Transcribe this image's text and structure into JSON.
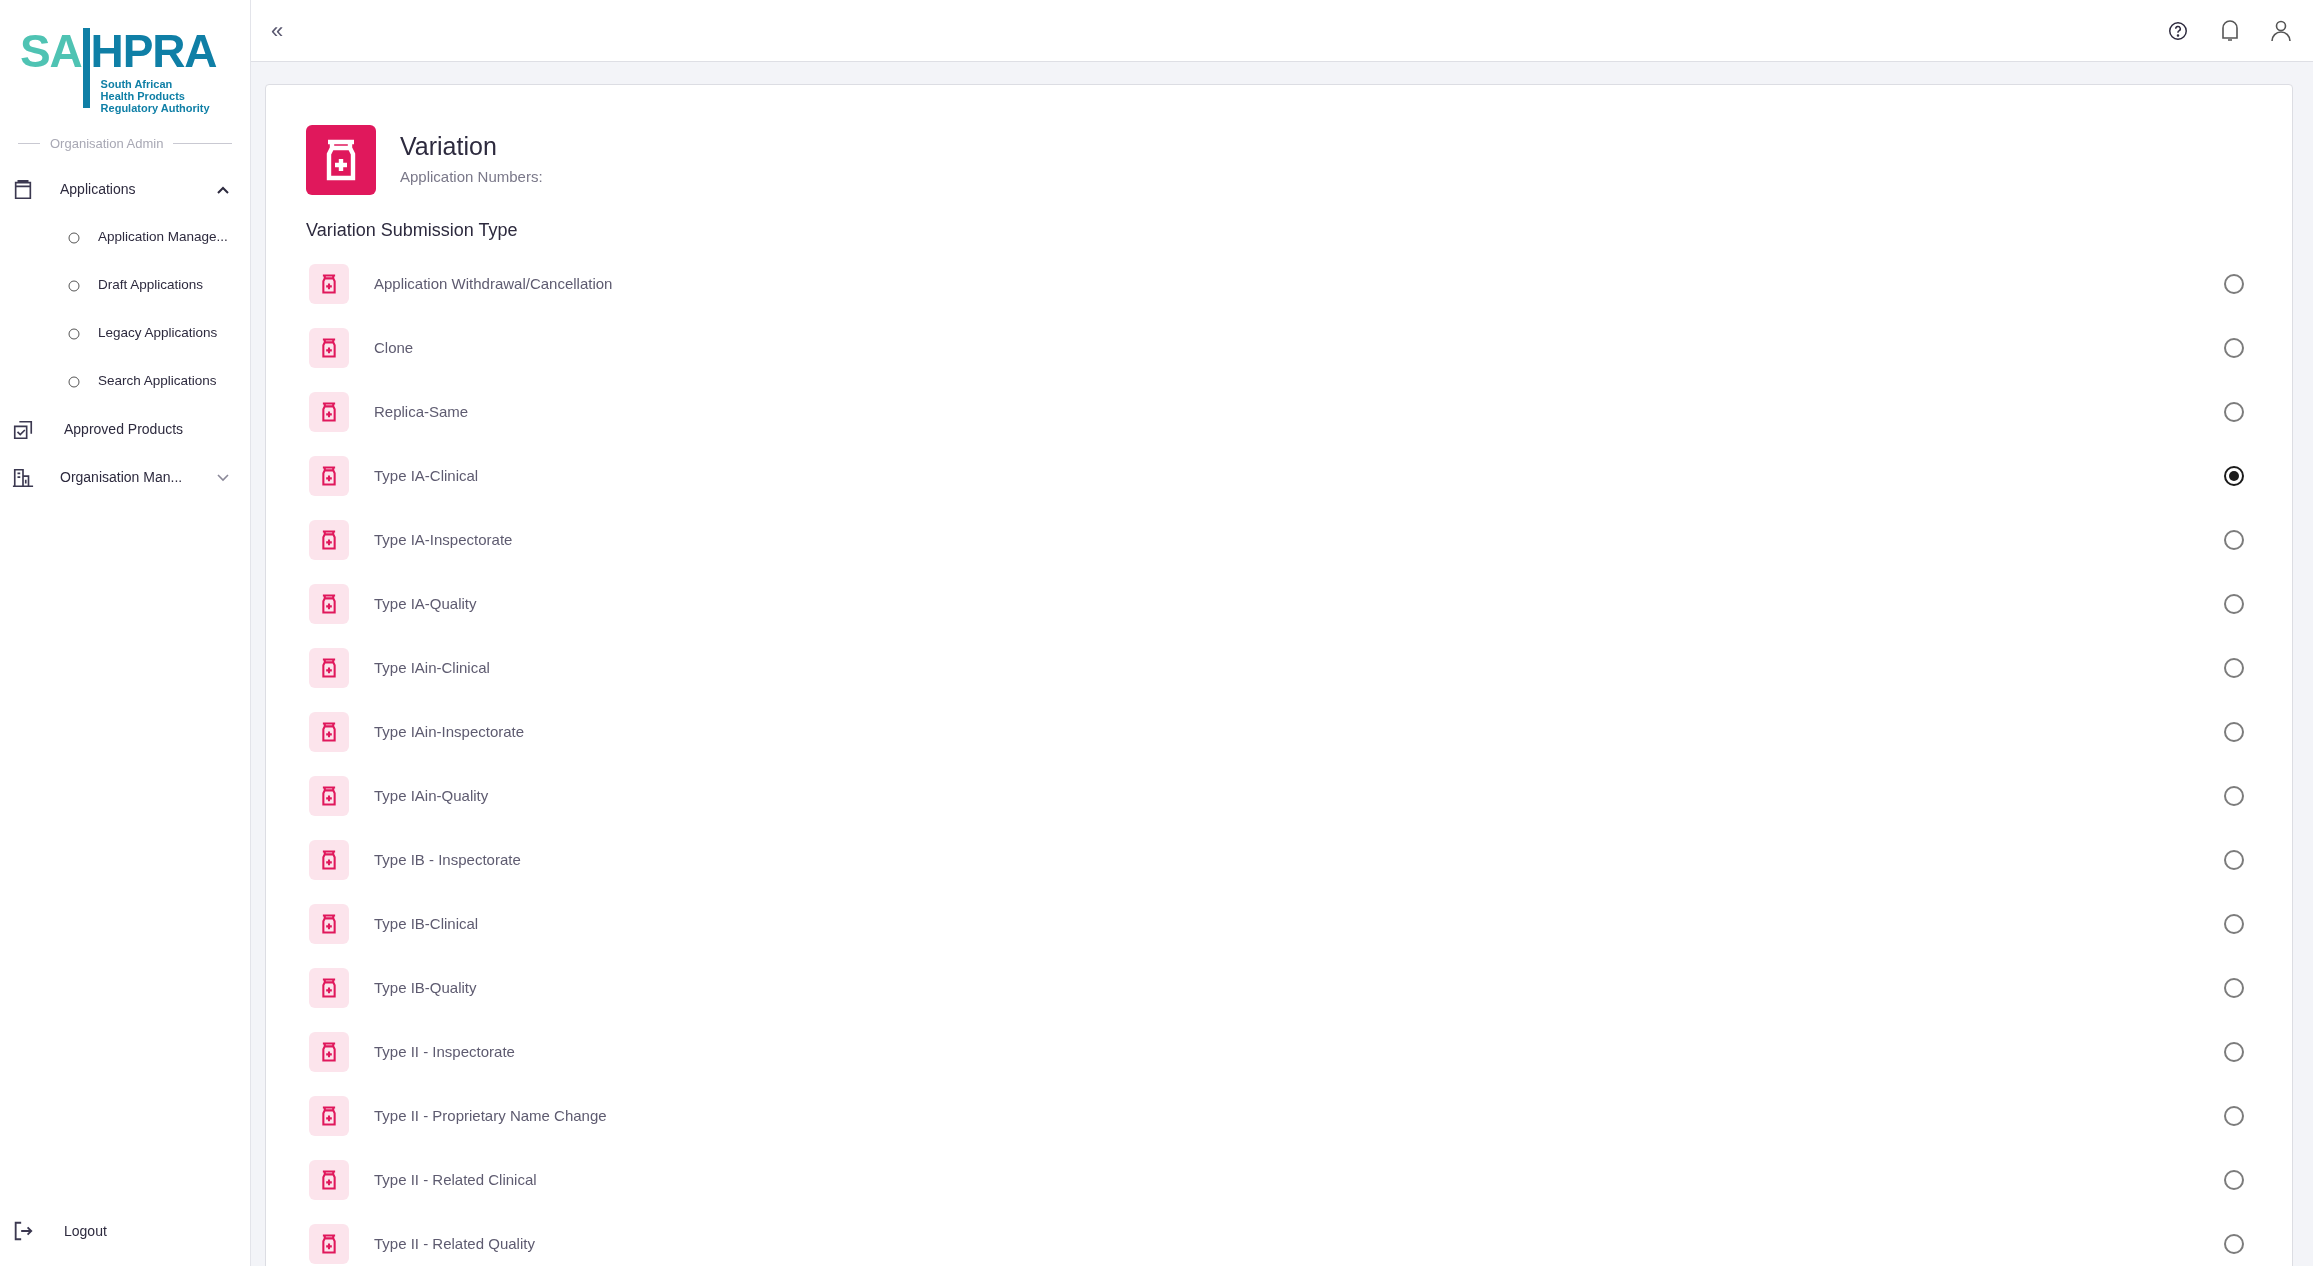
{
  "logo": {
    "mark_left": "SA",
    "mark_right": "HPRA",
    "subtitle_lines": [
      "South African",
      "Health Products",
      "Regulatory Authority"
    ]
  },
  "sidebar": {
    "section_label": "Organisation Admin",
    "items": [
      {
        "kind": "group",
        "label": "Applications",
        "expanded": true,
        "children": [
          {
            "label": "Application Manage..."
          },
          {
            "label": "Draft Applications"
          },
          {
            "label": "Legacy Applications"
          },
          {
            "label": "Search Applications"
          }
        ]
      },
      {
        "kind": "link",
        "label": "Approved Products"
      },
      {
        "kind": "group",
        "label": "Organisation Man...",
        "expanded": false
      }
    ],
    "logout": "Logout"
  },
  "collapse_button": "«",
  "header": {
    "title": "Variation",
    "subtitle": "Application Numbers:"
  },
  "section_title": "Variation Submission Type",
  "options": [
    {
      "label": "Application Withdrawal/Cancellation",
      "selected": false
    },
    {
      "label": "Clone",
      "selected": false
    },
    {
      "label": "Replica-Same",
      "selected": false
    },
    {
      "label": "Type IA-Clinical",
      "selected": true
    },
    {
      "label": "Type IA-Inspectorate",
      "selected": false
    },
    {
      "label": "Type IA-Quality",
      "selected": false
    },
    {
      "label": "Type IAin-Clinical",
      "selected": false
    },
    {
      "label": "Type IAin-Inspectorate",
      "selected": false
    },
    {
      "label": "Type IAin-Quality",
      "selected": false
    },
    {
      "label": "Type IB - Inspectorate",
      "selected": false
    },
    {
      "label": "Type IB-Clinical",
      "selected": false
    },
    {
      "label": "Type IB-Quality",
      "selected": false
    },
    {
      "label": "Type II - Inspectorate",
      "selected": false
    },
    {
      "label": "Type II - Proprietary Name Change",
      "selected": false
    },
    {
      "label": "Type II - Related Clinical",
      "selected": false
    },
    {
      "label": "Type II - Related Quality",
      "selected": false
    }
  ]
}
